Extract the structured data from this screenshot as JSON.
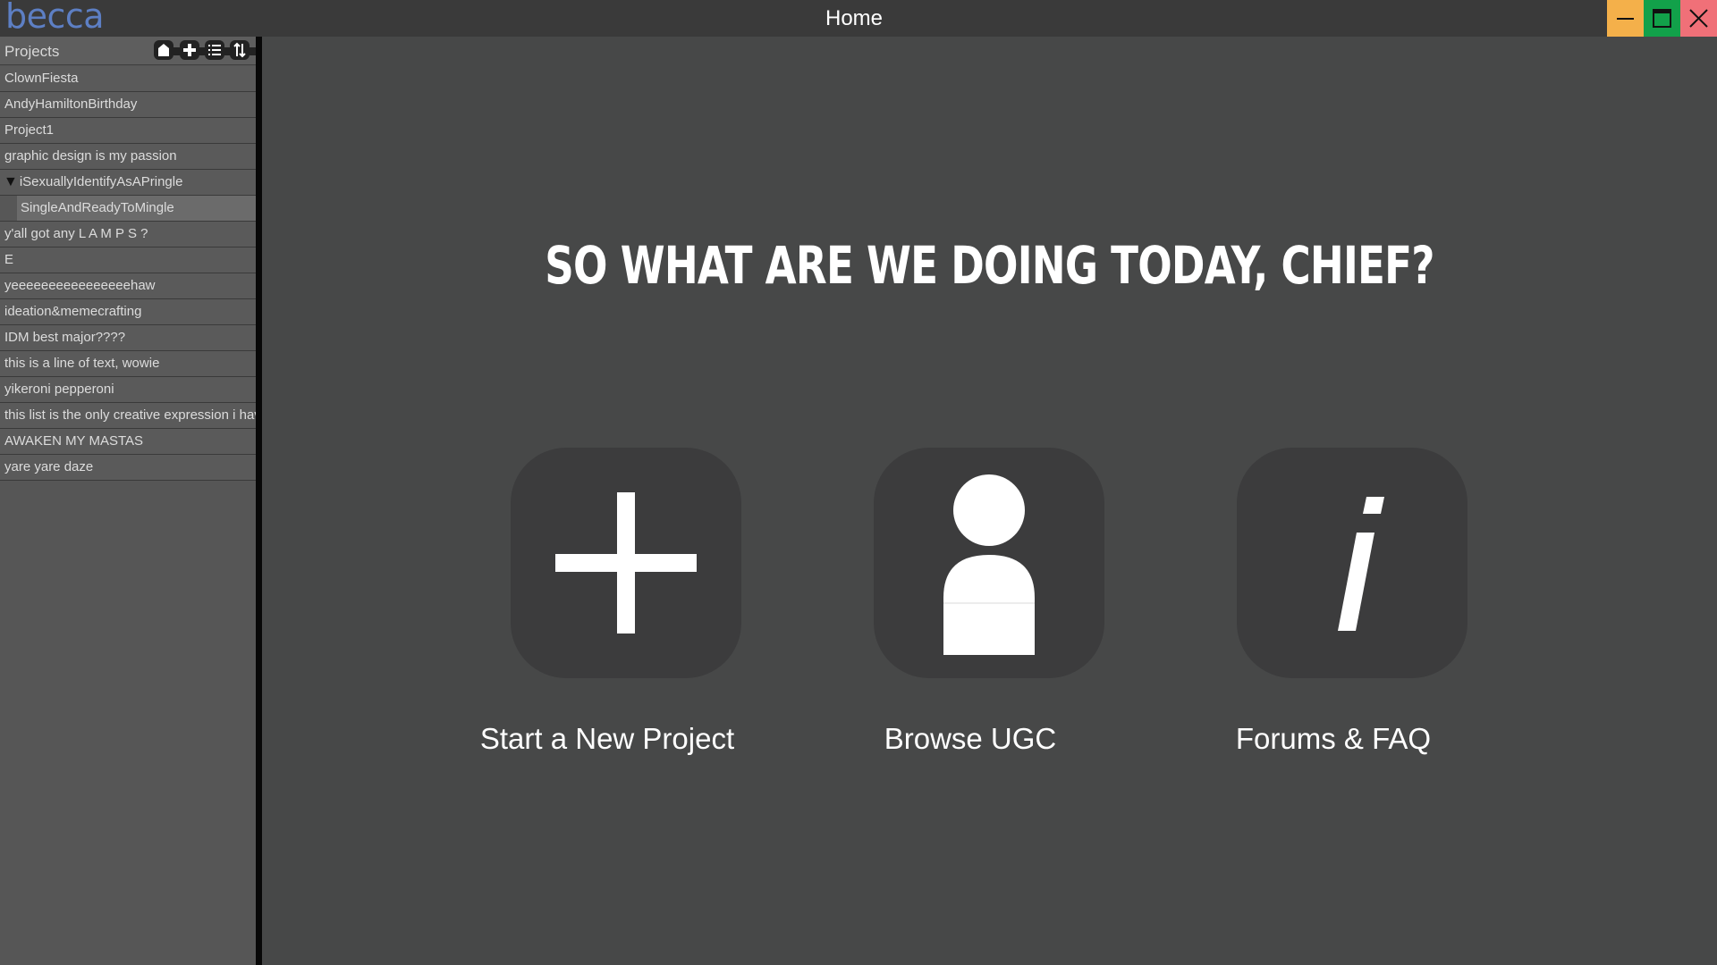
{
  "app": {
    "brand": "becca",
    "window_title": "Home"
  },
  "window_controls": {
    "minimize_color": "#f4b04a",
    "maximize_color": "#12a14a",
    "close_color": "#f07078"
  },
  "sidebar": {
    "header": "Projects",
    "toolbar": [
      "home-icon",
      "plus-icon",
      "list-icon",
      "sort-icon"
    ],
    "items": [
      {
        "label": "ClownFiesta"
      },
      {
        "label": "AndyHamiltonBirthday"
      },
      {
        "label": "Project1"
      },
      {
        "label": "graphic design is my passion"
      },
      {
        "label": "iSexuallyIdentifyAsAPringle",
        "expanded": true
      },
      {
        "label": "SingleAndReadyToMingle",
        "child": true
      },
      {
        "label": "y'all got any L A M P S ?"
      },
      {
        "label": "E"
      },
      {
        "label": "yeeeeeeeeeeeeeeeehaw"
      },
      {
        "label": "ideation&memecrafting"
      },
      {
        "label": "IDM best major????"
      },
      {
        "label": "this is a line of text, wowie"
      },
      {
        "label": "yikeroni pepperoni"
      },
      {
        "label": "this list is the only creative expression i have"
      },
      {
        "label": "AWAKEN MY MASTAS"
      },
      {
        "label": "yare yare daze"
      }
    ]
  },
  "main": {
    "headline": "SO WHAT ARE WE DOING TODAY, CHIEF?",
    "actions": [
      {
        "label": "Start a New Project",
        "icon": "plus-icon"
      },
      {
        "label": "Browse UGC",
        "icon": "user-icon"
      },
      {
        "label": "Forums & FAQ",
        "icon": "info-icon"
      }
    ]
  },
  "colors": {
    "brand": "#5d7fc4",
    "background": "#474848",
    "tile": "#3c3c3d"
  }
}
